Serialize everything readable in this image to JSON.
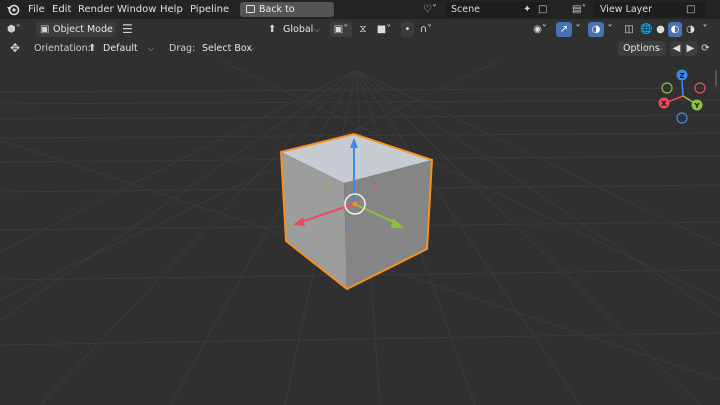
{
  "menu": {
    "items": [
      "File",
      "Edit",
      "Render",
      "Window",
      "Help",
      "Pipeline"
    ],
    "back_label": "Back to Previous",
    "scene_label": "Scene",
    "view_layer_label": "View Layer"
  },
  "viewport_header": {
    "mode_label": "Object Mode",
    "transform_orientation": "Global",
    "orientation_label": "Orientation:",
    "orientation_value": "Default",
    "drag_label": "Drag:",
    "drag_value": "Select Box",
    "options_label": "Options"
  },
  "gizmo": {
    "axes": [
      "Z",
      "X",
      "Y"
    ]
  },
  "colors": {
    "background": "#303030",
    "grid": "#3a3a3a",
    "selection_outline": "#f7911f",
    "x_axis": "#e64d5c",
    "y_axis": "#8ac33a",
    "z_axis": "#3c8ae6"
  }
}
